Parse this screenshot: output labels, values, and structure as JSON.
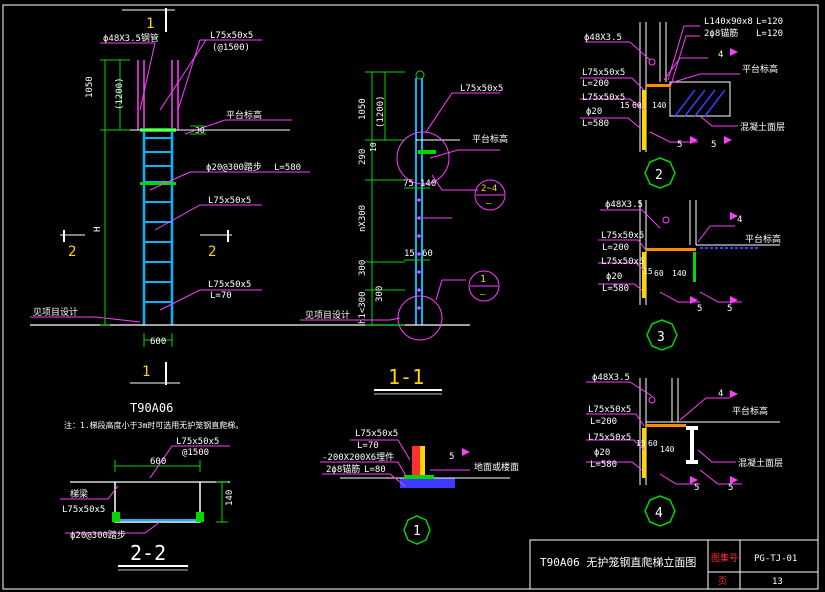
{
  "sheet": {
    "title": "T90A06 无护笼钢直爬梯立面图",
    "drawing_no_label": "图集号",
    "drawing_no": "PG-TJ-01",
    "page_label": "页",
    "page_no": "13"
  },
  "elev": {
    "section_mark": "1",
    "pipe_label": "ϕ48X3.5钢管",
    "angle_top_label": "L75x50x5",
    "angle_top_label2": "(@1500)",
    "dim_1050": "1050",
    "dim_1200": "(1200)",
    "dim_30": "30",
    "platform_label": "平台标高",
    "rung_label": "ϕ20@300踏步",
    "rung_length": "L=580",
    "angle_mid_label": "L75x50x5",
    "dim_h": "H",
    "side_mark_left": "2",
    "side_mark_right": "2",
    "angle_bot_label": "L75x50x5",
    "angle_bot_len": "L=70",
    "ground_label": "见项目设计",
    "dim_600": "600",
    "model_title": "T90A06",
    "note": "注：1.梯段高度小于3m时可选用无护笼钢直爬梯。"
  },
  "sec11": {
    "angle_label": "L75x50x5",
    "platform_label": "平台标高",
    "dim_1050": "1050",
    "dim_1200": "(1200)",
    "dim_290": "290",
    "dim_10": "10",
    "dim_75": "75",
    "dim_140": "140",
    "detail_ref": "2~4",
    "detail_ref_sub": "—",
    "dim_n300": "nX300",
    "dim_15": "15",
    "dim_60": "60",
    "dim_300a": "300",
    "dim_300b": "300",
    "dim_h1": "h1<300",
    "detail1_ref": "1",
    "detail1_sub": "—",
    "ground_label": "见项目设计",
    "title": "1-1"
  },
  "sec22": {
    "angle_label": "L75x50x5",
    "angle_label2": "@1500",
    "dim_600": "600",
    "dim_140": "140",
    "side_label": "梯梁",
    "side_angle": "L75x50x5",
    "rung_label": "ϕ20@300踏步",
    "title": "2-2"
  },
  "det1": {
    "angle": "L75x50x5",
    "len": "L=70",
    "plate": "-200X200X6埋件",
    "anchor": "2ϕ8锚筋",
    "anchor_len": "L=80",
    "weld": "5",
    "ground": "地面或楼面",
    "mark": "1"
  },
  "det2": {
    "pipe": "ϕ48X3.5",
    "angle_a": "L140x90x8",
    "angle_a_len": "L=120",
    "anchor": "2ϕ8锚筋",
    "anchor_len": "L=120",
    "angle1": "L75x50x5",
    "angle1_len": "L=200",
    "angle2": "L75x50x5",
    "rung": "ϕ20",
    "rung_len": "L=580",
    "weld4": "4",
    "weld5a": "5",
    "weld5b": "5",
    "dim_15": "15",
    "dim_60": "60",
    "dim_140": "140",
    "platform": "平台标高",
    "concrete": "混凝土面层",
    "mark": "2"
  },
  "det3": {
    "pipe": "ϕ48X3.5",
    "angle1": "L75x50x5",
    "angle1_len": "L=200",
    "angle2": "L75x50x5",
    "rung": "ϕ20",
    "rung_len": "L=580",
    "weld4": "4",
    "weld5a": "5",
    "weld5b": "5",
    "dim_15": "15",
    "dim_60": "60",
    "dim_140": "140",
    "platform": "平台标高",
    "mark": "3"
  },
  "det4": {
    "pipe": "ϕ48X3.5",
    "angle1": "L75x50x5",
    "angle1_len": "L=200",
    "angle2": "L75x50x5",
    "rung": "ϕ20",
    "rung_len": "L=580",
    "weld4": "4",
    "weld5a": "5",
    "weld5b": "5",
    "dim_15": "15",
    "dim_60": "60",
    "dim_140": "140",
    "platform": "平台标高",
    "concrete": "混凝土面层",
    "mark": "4"
  },
  "colors": {
    "background": "#000000",
    "leader": "#ff3dff",
    "dimension": "#00d800",
    "steel": "#00b7ff",
    "text": "#ffffff",
    "ref": "#ffd400",
    "hatch": "#3a3cff",
    "frame_red": "#ff3030"
  }
}
